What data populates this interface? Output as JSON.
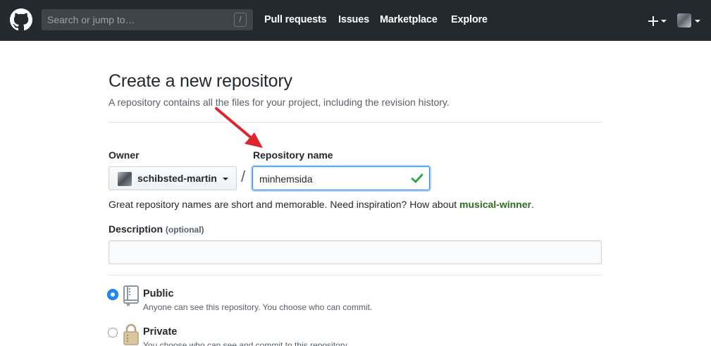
{
  "header": {
    "search_placeholder": "Search or jump to…",
    "search_shortcut": "/",
    "nav": [
      {
        "label": "Pull requests"
      },
      {
        "label": "Issues"
      },
      {
        "label": "Marketplace"
      },
      {
        "label": "Explore"
      }
    ],
    "plus_label": "+"
  },
  "page": {
    "title": "Create a new repository",
    "subtitle": "A repository contains all the files for your project, including the revision history."
  },
  "form": {
    "owner_label": "Owner",
    "owner_value": "schibsted-martin",
    "separator": "/",
    "repo_label": "Repository name",
    "repo_value": "minhemsida",
    "hint_text": "Great repository names are short and memorable. Need inspiration? How about",
    "hint_suggestion": "musical-winner",
    "hint_end": ".",
    "description_label": "Description",
    "description_optional": "(optional)",
    "description_value": "",
    "visibility": {
      "selected": "public",
      "public": {
        "title": "Public",
        "desc": "Anyone can see this repository. You choose who can commit."
      },
      "private": {
        "title": "Private",
        "desc": "You choose who can see and commit to this repository."
      }
    }
  },
  "colors": {
    "header_bg": "#24292e",
    "focus_blue": "#2188ff",
    "valid_green": "#28a745",
    "suggestion_green": "#2c6e1a",
    "annotation_arrow": "#e0242b"
  },
  "icons": {
    "logo": "github-octocat-icon",
    "check": "check-icon",
    "public": "repo-book-icon",
    "private": "lock-icon",
    "annotation": "red-arrow-annotation"
  }
}
